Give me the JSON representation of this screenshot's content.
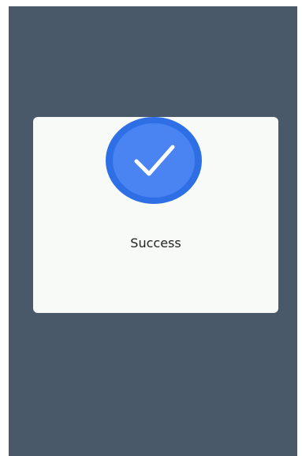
{
  "dialog": {
    "message": "Success",
    "icon": "checkmark-icon",
    "colors": {
      "overlay": "#4a596a",
      "card": "#f7faf7",
      "badge_outer": "#2f6fe6",
      "badge_inner": "#4a84f3",
      "check": "#ffffff",
      "text": "#222222"
    }
  }
}
